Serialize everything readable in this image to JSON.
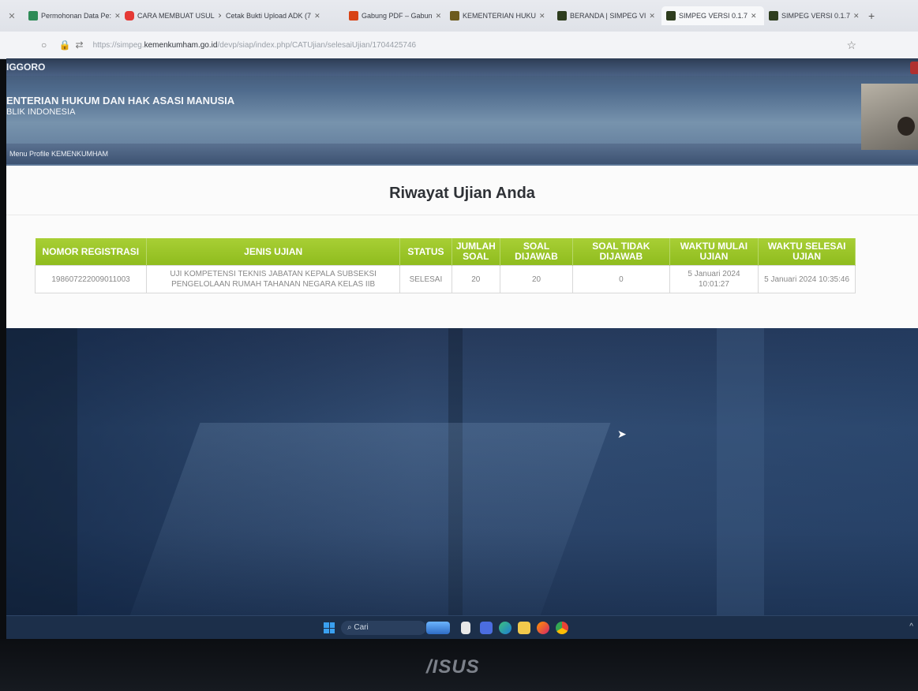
{
  "browser": {
    "tabs": [
      {
        "label": "Permohonan Data Pe:",
        "color": "#2e8b57"
      },
      {
        "label": "CARA MEMBUAT USUL",
        "color": "#e53935"
      },
      {
        "label": "Cetak Bukti Upload ADK (7",
        "color": "#9e9e9e"
      },
      {
        "label": "Gabung PDF – Gabun",
        "color": "#d84315"
      },
      {
        "label": "KEMENTERIAN HUKU",
        "color": "#6d5b1e"
      },
      {
        "label": "BERANDA | SIMPEG VI",
        "color": "#2e3d1e"
      },
      {
        "label": "SIMPEG VERSI 0.1.7",
        "color": "#2e3d1e"
      },
      {
        "label": "SIMPEG VERSI 0.1.7",
        "color": "#2e3d1e"
      }
    ],
    "url_prefix": "https://simpeg.",
    "url_domain": "kemenkumham.go.id",
    "url_path": "/devp/siap/index.php/CATUjian/selesaiUjian/1704425746"
  },
  "header": {
    "top_name": "IGGORO",
    "org_line1": "ENTERIAN HUKUM DAN HAK ASASI MANUSIA",
    "org_line2": "BLIK INDONESIA",
    "menu_label": "Menu Profile KEMENKUMHAM"
  },
  "page": {
    "title": "Riwayat Ujian Anda",
    "table": {
      "headers": [
        "NOMOR REGISTRASI",
        "JENIS UJIAN",
        "STATUS",
        "JUMLAH SOAL",
        "SOAL DIJAWAB",
        "SOAL TIDAK DIJAWAB",
        "WAKTU MULAI UJIAN",
        "WAKTU SELESAI UJIAN"
      ],
      "rows": [
        [
          "198607222009011003",
          "UJI KOMPETENSI TEKNIS JABATAN KEPALA SUBSEKSI PENGELOLAAN RUMAH TAHANAN NEGARA KELAS IIB",
          "SELESAI",
          "20",
          "20",
          "0",
          "5 Januari 2024 10:01:27",
          "5 Januari 2024 10:35:46"
        ]
      ]
    }
  },
  "taskbar": {
    "search_label": "Cari"
  },
  "laptop": {
    "brand": "/ISUS"
  }
}
